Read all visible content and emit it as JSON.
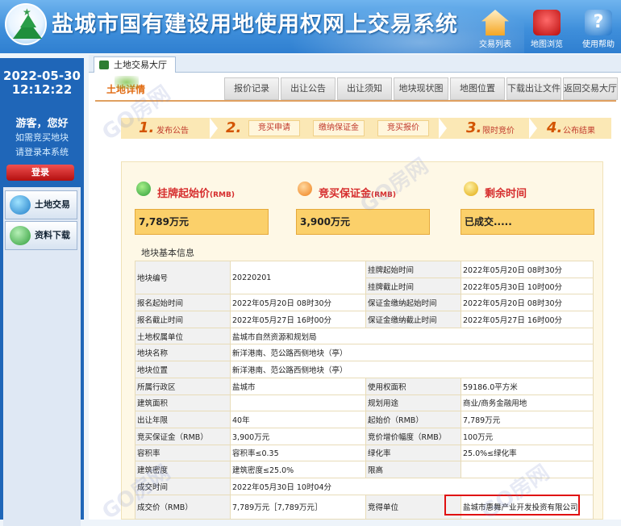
{
  "header": {
    "title": "盐城市国有建设用地使用权网上交易系统",
    "icons": [
      {
        "name": "house-icon",
        "label": "交易列表"
      },
      {
        "name": "map-icon",
        "label": "地图浏览"
      },
      {
        "name": "help-icon",
        "label": "使用帮助"
      }
    ]
  },
  "sidebar": {
    "date": "2022-05-30",
    "time": "12:12:22",
    "greeting": "游客，您好",
    "link1": "如需竞买地块",
    "link2": "请登录本系统",
    "login": "登录",
    "menu": [
      {
        "label": "土地交易",
        "icon": "globe-icon"
      },
      {
        "label": "资料下载",
        "icon": "download-icon"
      }
    ]
  },
  "tabbar": {
    "tab": "土地交易大厅"
  },
  "subnav": {
    "title": "土地详情",
    "items": [
      "报价记录",
      "出让公告",
      "出让须知",
      "地块现状图",
      "地图位置",
      "下载出让文件",
      "返回交易大厅"
    ]
  },
  "steps": {
    "s1": {
      "num": "1.",
      "label": "发布公告"
    },
    "s2": {
      "num": "2.",
      "items": [
        "竞买申请",
        "缴纳保证金",
        "竞买报价"
      ]
    },
    "s3": {
      "num": "3.",
      "label": "限时竞价"
    },
    "s4": {
      "num": "4.",
      "label": "公布结果"
    }
  },
  "kpi": {
    "start_price": {
      "title": "挂牌起始价",
      "unit": "(RMB)",
      "value": "7,789万元"
    },
    "deposit": {
      "title": "竞买保证金",
      "unit": "(RMB)",
      "value": "3,900万元"
    },
    "remaining": {
      "title": "剩余时间",
      "value": "已成交....."
    }
  },
  "section": {
    "title": "地块基本信息"
  },
  "table": {
    "r1": {
      "k1": "地块编号",
      "v1": "20220201",
      "k2a": "挂牌起始时间",
      "v2a": "2022年05月20日 08时30分",
      "k2b": "挂牌截止时间",
      "v2b": "2022年05月30日 10时00分"
    },
    "r2": {
      "k1": "报名起始时间",
      "v1": "2022年05月20日 08时30分",
      "k2": "保证金缴纳起始时间",
      "v2": "2022年05月20日 08时30分"
    },
    "r3": {
      "k1": "报名截止时间",
      "v1": "2022年05月27日 16时00分",
      "k2": "保证金缴纳截止时间",
      "v2": "2022年05月27日 16时00分"
    },
    "r4": {
      "k1": "土地权属单位",
      "v1": "盐城市自然资源和规划局"
    },
    "r5": {
      "k1": "地块名称",
      "v1": "新洋港南、范公路西侧地块（亭）"
    },
    "r6": {
      "k1": "地块位置",
      "v1": "新洋港南、范公路西侧地块（亭）"
    },
    "r7": {
      "k1": "所属行政区",
      "v1": "盐城市",
      "k2": "使用权面积",
      "v2": "59186.0平方米"
    },
    "r8": {
      "k1": "建筑面积",
      "v1": "",
      "k2": "规划用途",
      "v2": "商业/商务金融用地"
    },
    "r9": {
      "k1": "出让年限",
      "v1": "40年",
      "k2": "起始价（RMB）",
      "v2": "7,789万元"
    },
    "r10": {
      "k1": "竞买保证金（RMB）",
      "v1": "3,900万元",
      "k2": "竞价增价幅度（RMB）",
      "v2": "100万元"
    },
    "r11": {
      "k1": "容积率",
      "v1": "容积率≤0.35",
      "k2": "绿化率",
      "v2": "25.0%≤绿化率"
    },
    "r12": {
      "k1": "建筑密度",
      "v1": "建筑密度≤25.0%",
      "k2": "限高",
      "v2": ""
    },
    "r13": {
      "k1": "成交时间",
      "v1": "2022年05月30日 10时04分"
    },
    "r14": {
      "k1": "成交价（RMB）",
      "v1": "7,789万元［7,789万元］",
      "k2": "竞得单位",
      "v2": "盐城市惠舞产业开发投资有限公司"
    }
  },
  "watermark": "GO房网"
}
